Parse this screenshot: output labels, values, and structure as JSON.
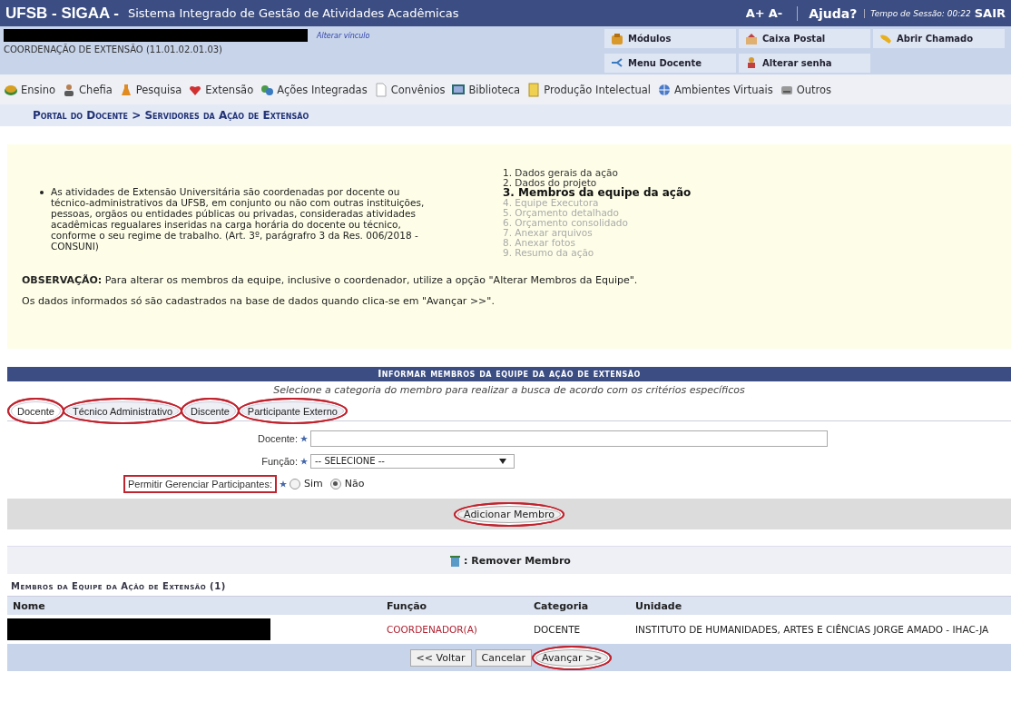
{
  "header": {
    "system": "UFSB - SIGAA -",
    "title": "Sistema Integrado de Gestão de Atividades Acadêmicas",
    "font_up": "A+",
    "font_down": "A-",
    "help": "Ajuda?",
    "session_label": "Tempo de Sessão:",
    "session_time": "00:22",
    "logout": "SAIR"
  },
  "user": {
    "change_link": "Alterar vínculo",
    "unit": "COORDENAÇÃO DE EXTENSÃO (11.01.02.01.03)"
  },
  "quick_links": [
    {
      "label": "Módulos"
    },
    {
      "label": "Caixa Postal"
    },
    {
      "label": "Abrir Chamado"
    },
    {
      "label": "Menu Docente"
    },
    {
      "label": "Alterar senha"
    }
  ],
  "menu": [
    {
      "label": "Ensino"
    },
    {
      "label": "Chefia"
    },
    {
      "label": "Pesquisa"
    },
    {
      "label": "Extensão"
    },
    {
      "label": "Ações Integradas"
    },
    {
      "label": "Convênios"
    },
    {
      "label": "Biblioteca"
    },
    {
      "label": "Produção Intelectual"
    },
    {
      "label": "Ambientes Virtuais"
    },
    {
      "label": "Outros"
    }
  ],
  "breadcrumb": "Portal do Docente > Servidores da Ação de Extensão",
  "info": {
    "bullet": "As atividades de Extensão Universitária são coordenadas por docente ou técnico-administrativos da UFSB, em conjunto ou não com outras instituições, pessoas, orgãos ou entidades públicas ou privadas, consideradas atividades acadêmicas regualares inseridas na carga horária do docente ou técnico, conforme o seu regime de trabalho. (Art. 3º, parágrafro 3 da Res. 006/2018 - CONSUNI)",
    "steps": [
      {
        "label": "1. Dados gerais da ação",
        "selected": false,
        "disabled": false
      },
      {
        "label": "2. Dados do projeto",
        "selected": false,
        "disabled": false
      },
      {
        "label": "3. Membros da equipe da ação",
        "selected": true,
        "disabled": false
      },
      {
        "label": "4. Equipe Executora",
        "selected": false,
        "disabled": true
      },
      {
        "label": "5. Orçamento detalhado",
        "selected": false,
        "disabled": true
      },
      {
        "label": "6. Orçamento consolidado",
        "selected": false,
        "disabled": true
      },
      {
        "label": "7. Anexar arquivos",
        "selected": false,
        "disabled": true
      },
      {
        "label": "8. Anexar fotos",
        "selected": false,
        "disabled": true
      },
      {
        "label": "9. Resumo da ação",
        "selected": false,
        "disabled": true
      }
    ],
    "note": "**OBSERVAÇÃO:** Para alterar os membros da equipe, inclusive o coordenador, utilize a opção \"Alterar Membros da Equipe\".",
    "note2": "Os dados informados só são cadastrados na base de dados quando clica-se em \"Avançar >>\"."
  },
  "form": {
    "title": "Informar membros da equipe da ação de extensão",
    "subtitle": "Selecione a categoria do membro para realizar a busca de acordo com os critérios específicos",
    "tabs": [
      {
        "label": "Docente",
        "selected": true,
        "annotated": true
      },
      {
        "label": "Técnico Administrativo",
        "selected": false,
        "annotated": true
      },
      {
        "label": "Discente",
        "selected": false,
        "annotated": true
      },
      {
        "label": "Participante Externo",
        "selected": false,
        "annotated": true
      }
    ],
    "docente_label": "Docente:",
    "funcao_label": "Função:",
    "funcao_value": "-- SELECIONE --",
    "permitir": {
      "label": "Permitir Gerenciar Participantes:",
      "annotated": true,
      "options": [
        {
          "label": "Sim",
          "selected": false
        },
        {
          "label": "Não",
          "selected": true
        }
      ]
    },
    "add_button": {
      "label": "Adicionar Membro",
      "annotated": true
    },
    "legend": ": Remover Membro"
  },
  "members": {
    "title": "Membros da Equipe da Ação de Extensão (1)",
    "columns": [
      "Nome",
      "Função",
      "Categoria",
      "Unidade"
    ],
    "rows": [
      {
        "name_redacted": true,
        "funcao": "COORDENADOR(A)",
        "categoria": "DOCENTE",
        "unidade": "INSTITUTO DE HUMANIDADES, ARTES E CIÊNCIAS JORGE AMADO - IHAC-JA"
      }
    ]
  },
  "buttons": [
    {
      "label": "<< Voltar",
      "annotated": false
    },
    {
      "label": "Cancelar",
      "annotated": false
    },
    {
      "label": "Avançar >>",
      "annotated": true
    }
  ]
}
